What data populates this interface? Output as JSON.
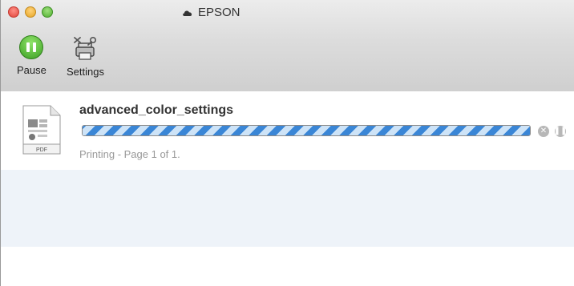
{
  "window": {
    "title": "EPSON"
  },
  "toolbar": {
    "pause_label": "Pause",
    "settings_label": "Settings"
  },
  "job": {
    "name": "advanced_color_settings",
    "status": "Printing - Page 1 of 1.",
    "icon_label": "PDF",
    "progress_fraction": 1.0
  },
  "icons": {
    "window_title": "cloud-icon",
    "pause": "pause-icon",
    "settings": "printer-settings-icon",
    "job_file": "pdf-document-icon",
    "cancel": "cancel-icon",
    "hold": "pause-job-icon"
  },
  "colors": {
    "close": "#e0443a",
    "minimize": "#e6a524",
    "zoom": "#4fae2f",
    "pause_button": "#3c9f23",
    "progress": "#3a86d6"
  }
}
